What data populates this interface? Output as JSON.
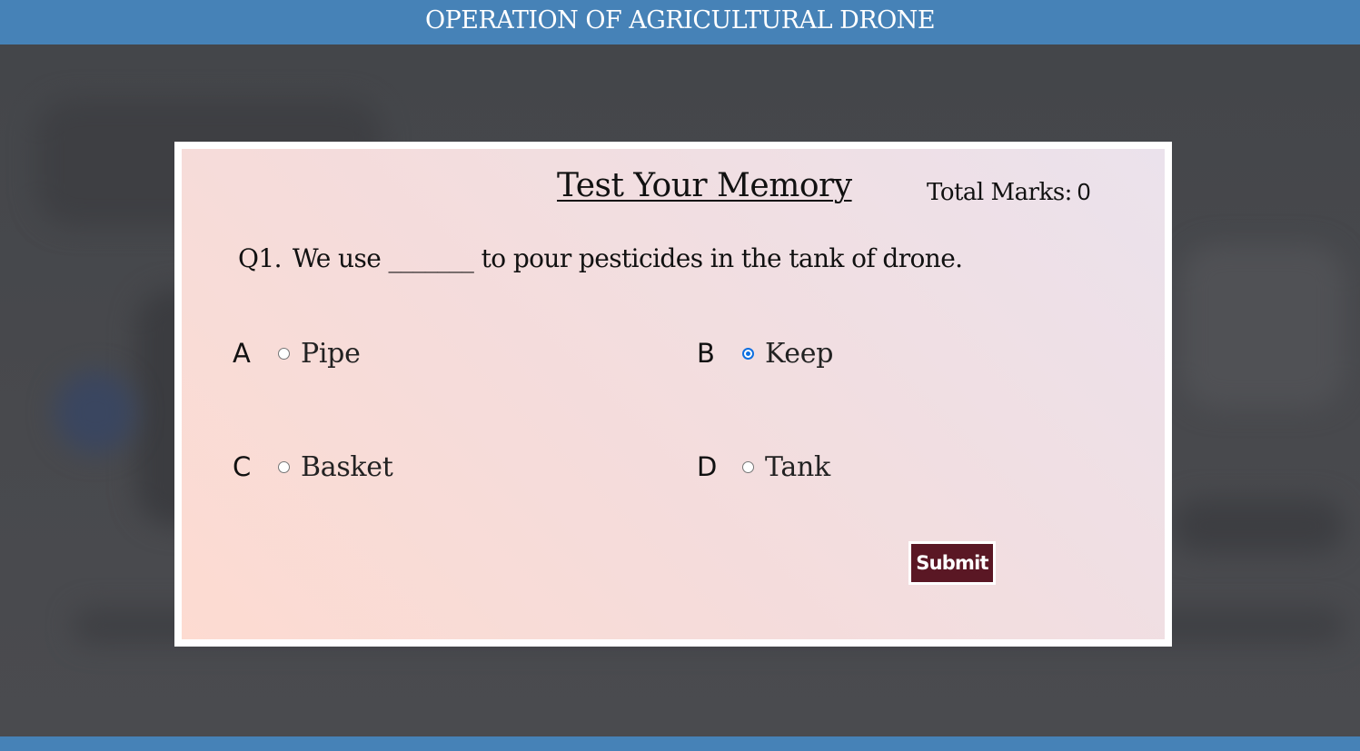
{
  "header": {
    "title": "OPERATION OF AGRICULTURAL DRONE"
  },
  "quiz": {
    "title": "Test Your Memory",
    "marks_label": "Total Marks:",
    "marks_value": "0",
    "question_number": "Q1.",
    "question_text": "We use _______ to pour pesticides in the tank of drone.",
    "options": [
      {
        "letter": "A",
        "text": "Pipe",
        "selected": false
      },
      {
        "letter": "B",
        "text": "Keep",
        "selected": true
      },
      {
        "letter": "C",
        "text": "Basket",
        "selected": false
      },
      {
        "letter": "D",
        "text": "Tank",
        "selected": false
      }
    ],
    "submit_label": "Submit"
  },
  "colors": {
    "header_bg": "#4682b7",
    "submit_bg": "#5a1724",
    "radio_accent": "#0f6fe0"
  }
}
